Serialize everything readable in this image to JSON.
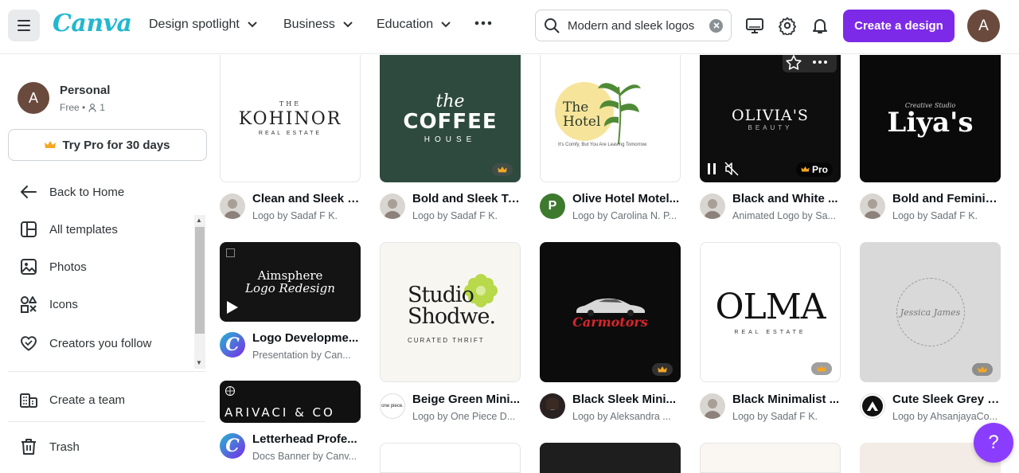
{
  "header": {
    "logo": "Canva",
    "nav": [
      "Design spotlight",
      "Business",
      "Education"
    ],
    "search_value": "Modern and sleek logos",
    "create_label": "Create a design",
    "avatar_initial": "A"
  },
  "sidebar": {
    "account_name": "Personal",
    "account_plan": "Free •",
    "account_members": "1",
    "avatar_initial": "A",
    "try_pro_label": "Try Pro for 30 days",
    "items": [
      {
        "label": "Back to Home"
      },
      {
        "label": "All templates"
      },
      {
        "label": "Photos"
      },
      {
        "label": "Icons"
      },
      {
        "label": "Creators you follow"
      },
      {
        "label": "Create a team"
      },
      {
        "label": "Trash"
      }
    ]
  },
  "colors": {
    "brand_purple": "#7d2ae8",
    "logo_teal": "#22b8cf",
    "crown_gold": "#f5a623"
  },
  "templates": [
    {
      "title": "Clean and Sleek T...",
      "subtitle": "Logo by Sadaf F K.",
      "thumb_line1": "THE",
      "thumb_line2": "KOHINOR",
      "thumb_line3": "REAL ESTATE"
    },
    {
      "title": "Bold and Sleek Ty...",
      "subtitle": "Logo by Sadaf F K.",
      "thumb_line1": "the",
      "thumb_line2": "COFFEE",
      "thumb_line3": "HOUSE"
    },
    {
      "title": "Olive Hotel Motel...",
      "subtitle": "Logo by Carolina N. P...",
      "avatar_initial": "P",
      "thumb_line1": "The",
      "thumb_line2": "Hotel",
      "thumb_line3": "It's Comfy, But You Are Leaving Tomorrow"
    },
    {
      "title": "Black and White ...",
      "subtitle": "Animated Logo by Sa...",
      "thumb_line1": "OLIVIA'S",
      "thumb_line2": "BEAUTY",
      "badge": "Pro"
    },
    {
      "title": "Bold and Feminin...",
      "subtitle": "Logo by Sadaf F K.",
      "thumb_line1": "Creative Studio",
      "thumb_line2": "Liya's"
    },
    {
      "title": "Logo Developme...",
      "subtitle": "Presentation by Can...",
      "thumb_line1": "Aimsphere",
      "thumb_line2": "Logo Redesign"
    },
    {
      "title": "Beige Green Mini...",
      "subtitle": "Logo by One Piece D...",
      "avatar_text": "one piece.",
      "thumb_line1": "Studio",
      "thumb_line2": "Shodwe.",
      "thumb_line3": "CURATED THRIFT"
    },
    {
      "title": "Black Sleek Mini...",
      "subtitle": "Logo by Aleksandra ...",
      "thumb_line1": "Carmotors"
    },
    {
      "title": "Black Minimalist ...",
      "subtitle": "Logo by Sadaf F K.",
      "thumb_line1": "OLMA",
      "thumb_line2": "REAL ESTATE"
    },
    {
      "title": "Cute Sleek Grey B...",
      "subtitle": "Logo by AhsanjayaCo...",
      "thumb_line1": "Jessica James"
    },
    {
      "title": "Letterhead Profe...",
      "subtitle": "Docs Banner by Canv...",
      "thumb_line1": "ARIVACI & CO"
    }
  ],
  "help_label": "?"
}
